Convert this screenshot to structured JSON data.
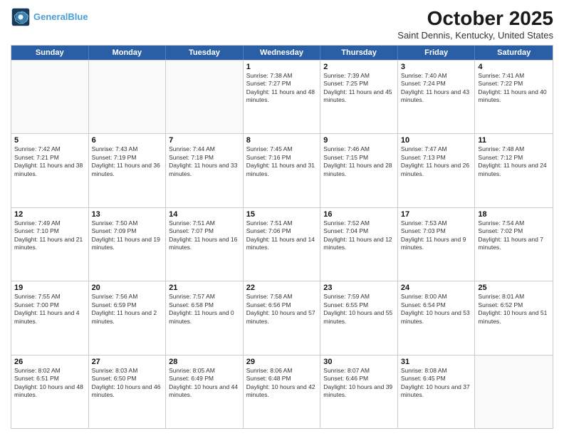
{
  "header": {
    "logo_line1": "General",
    "logo_line2": "Blue",
    "month": "October 2025",
    "location": "Saint Dennis, Kentucky, United States"
  },
  "days_of_week": [
    "Sunday",
    "Monday",
    "Tuesday",
    "Wednesday",
    "Thursday",
    "Friday",
    "Saturday"
  ],
  "weeks": [
    [
      {
        "day": "",
        "text": ""
      },
      {
        "day": "",
        "text": ""
      },
      {
        "day": "",
        "text": ""
      },
      {
        "day": "1",
        "text": "Sunrise: 7:38 AM\nSunset: 7:27 PM\nDaylight: 11 hours and 48 minutes."
      },
      {
        "day": "2",
        "text": "Sunrise: 7:39 AM\nSunset: 7:25 PM\nDaylight: 11 hours and 45 minutes."
      },
      {
        "day": "3",
        "text": "Sunrise: 7:40 AM\nSunset: 7:24 PM\nDaylight: 11 hours and 43 minutes."
      },
      {
        "day": "4",
        "text": "Sunrise: 7:41 AM\nSunset: 7:22 PM\nDaylight: 11 hours and 40 minutes."
      }
    ],
    [
      {
        "day": "5",
        "text": "Sunrise: 7:42 AM\nSunset: 7:21 PM\nDaylight: 11 hours and 38 minutes."
      },
      {
        "day": "6",
        "text": "Sunrise: 7:43 AM\nSunset: 7:19 PM\nDaylight: 11 hours and 36 minutes."
      },
      {
        "day": "7",
        "text": "Sunrise: 7:44 AM\nSunset: 7:18 PM\nDaylight: 11 hours and 33 minutes."
      },
      {
        "day": "8",
        "text": "Sunrise: 7:45 AM\nSunset: 7:16 PM\nDaylight: 11 hours and 31 minutes."
      },
      {
        "day": "9",
        "text": "Sunrise: 7:46 AM\nSunset: 7:15 PM\nDaylight: 11 hours and 28 minutes."
      },
      {
        "day": "10",
        "text": "Sunrise: 7:47 AM\nSunset: 7:13 PM\nDaylight: 11 hours and 26 minutes."
      },
      {
        "day": "11",
        "text": "Sunrise: 7:48 AM\nSunset: 7:12 PM\nDaylight: 11 hours and 24 minutes."
      }
    ],
    [
      {
        "day": "12",
        "text": "Sunrise: 7:49 AM\nSunset: 7:10 PM\nDaylight: 11 hours and 21 minutes."
      },
      {
        "day": "13",
        "text": "Sunrise: 7:50 AM\nSunset: 7:09 PM\nDaylight: 11 hours and 19 minutes."
      },
      {
        "day": "14",
        "text": "Sunrise: 7:51 AM\nSunset: 7:07 PM\nDaylight: 11 hours and 16 minutes."
      },
      {
        "day": "15",
        "text": "Sunrise: 7:51 AM\nSunset: 7:06 PM\nDaylight: 11 hours and 14 minutes."
      },
      {
        "day": "16",
        "text": "Sunrise: 7:52 AM\nSunset: 7:04 PM\nDaylight: 11 hours and 12 minutes."
      },
      {
        "day": "17",
        "text": "Sunrise: 7:53 AM\nSunset: 7:03 PM\nDaylight: 11 hours and 9 minutes."
      },
      {
        "day": "18",
        "text": "Sunrise: 7:54 AM\nSunset: 7:02 PM\nDaylight: 11 hours and 7 minutes."
      }
    ],
    [
      {
        "day": "19",
        "text": "Sunrise: 7:55 AM\nSunset: 7:00 PM\nDaylight: 11 hours and 4 minutes."
      },
      {
        "day": "20",
        "text": "Sunrise: 7:56 AM\nSunset: 6:59 PM\nDaylight: 11 hours and 2 minutes."
      },
      {
        "day": "21",
        "text": "Sunrise: 7:57 AM\nSunset: 6:58 PM\nDaylight: 11 hours and 0 minutes."
      },
      {
        "day": "22",
        "text": "Sunrise: 7:58 AM\nSunset: 6:56 PM\nDaylight: 10 hours and 57 minutes."
      },
      {
        "day": "23",
        "text": "Sunrise: 7:59 AM\nSunset: 6:55 PM\nDaylight: 10 hours and 55 minutes."
      },
      {
        "day": "24",
        "text": "Sunrise: 8:00 AM\nSunset: 6:54 PM\nDaylight: 10 hours and 53 minutes."
      },
      {
        "day": "25",
        "text": "Sunrise: 8:01 AM\nSunset: 6:52 PM\nDaylight: 10 hours and 51 minutes."
      }
    ],
    [
      {
        "day": "26",
        "text": "Sunrise: 8:02 AM\nSunset: 6:51 PM\nDaylight: 10 hours and 48 minutes."
      },
      {
        "day": "27",
        "text": "Sunrise: 8:03 AM\nSunset: 6:50 PM\nDaylight: 10 hours and 46 minutes."
      },
      {
        "day": "28",
        "text": "Sunrise: 8:05 AM\nSunset: 6:49 PM\nDaylight: 10 hours and 44 minutes."
      },
      {
        "day": "29",
        "text": "Sunrise: 8:06 AM\nSunset: 6:48 PM\nDaylight: 10 hours and 42 minutes."
      },
      {
        "day": "30",
        "text": "Sunrise: 8:07 AM\nSunset: 6:46 PM\nDaylight: 10 hours and 39 minutes."
      },
      {
        "day": "31",
        "text": "Sunrise: 8:08 AM\nSunset: 6:45 PM\nDaylight: 10 hours and 37 minutes."
      },
      {
        "day": "",
        "text": ""
      }
    ]
  ]
}
